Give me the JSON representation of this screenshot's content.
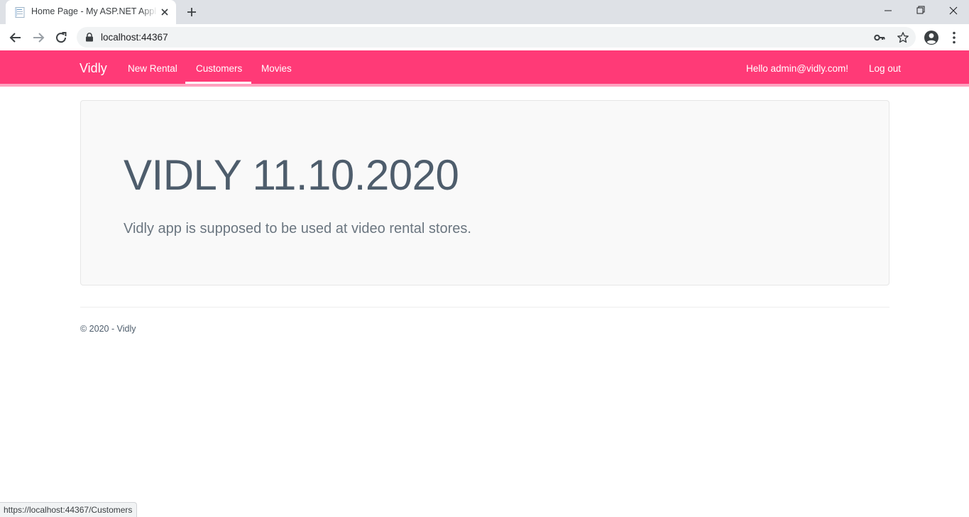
{
  "browser": {
    "tab": {
      "title": "Home Page - My ASP.NET Application",
      "favicon": "document-icon"
    },
    "address": {
      "url": "localhost:44367"
    },
    "status_url": "https://localhost:44367/Customers"
  },
  "navbar": {
    "brand": "Vidly",
    "links": [
      {
        "label": "New Rental"
      },
      {
        "label": "Customers"
      },
      {
        "label": "Movies"
      }
    ],
    "active_link": "Customers",
    "greeting": "Hello admin@vidly.com!",
    "logout": "Log out",
    "color": "#ff3a77"
  },
  "jumbotron": {
    "title": "VIDLY 11.10.2020",
    "lead": "Vidly app is supposed to be used at video rental stores."
  },
  "footer": {
    "text": "© 2020 - Vidly"
  }
}
